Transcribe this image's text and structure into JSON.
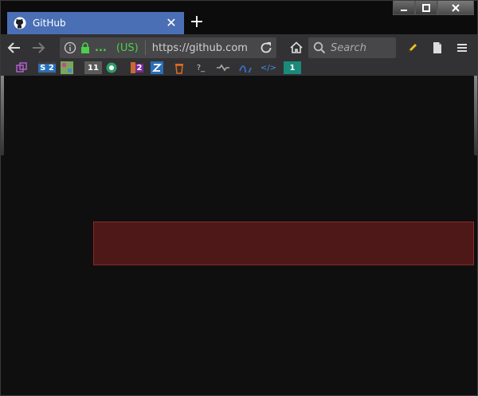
{
  "tab": {
    "title": "GitHub",
    "close_symbol": "✕"
  },
  "newtab": {
    "symbol": "+"
  },
  "url": {
    "ellipsis": "...",
    "owner": "(US)",
    "text": "https://github.com"
  },
  "search": {
    "placeholder": "Search"
  },
  "extensions": [
    {
      "label": "S 2",
      "color": "#2a6fb8"
    },
    {
      "label": "11",
      "color": "#6a2a2a"
    },
    {
      "label": "2",
      "color": "#7a2a9a"
    },
    {
      "label": "?_",
      "color": "#323234"
    },
    {
      "label": "</>",
      "color": "#323234"
    },
    {
      "label": "1",
      "color": "#1a8a7a"
    }
  ],
  "colors": {
    "accent_tab": "#4a6fb5",
    "toolbar": "#323234",
    "secure_green": "#4ccf4c",
    "highlight": "#7a2020"
  }
}
